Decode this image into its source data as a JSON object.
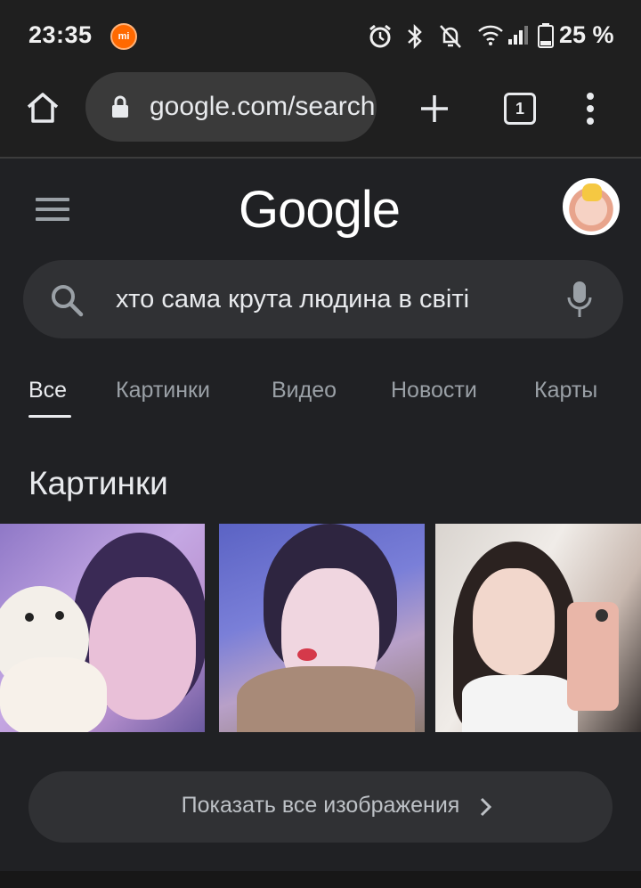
{
  "status_bar": {
    "time": "23:35",
    "mi_badge": "mi",
    "battery": "25 %",
    "icons": [
      "alarm-icon",
      "bluetooth-icon",
      "notifications-off-icon",
      "wifi-icon",
      "signal-icon",
      "battery-icon"
    ]
  },
  "browser": {
    "url": "google.com/search",
    "tab_count": "1",
    "icons": [
      "home-icon",
      "lock-icon",
      "new-tab-icon",
      "tab-switcher-icon",
      "more-menu-icon"
    ]
  },
  "google": {
    "logo": "Google"
  },
  "search": {
    "query": "хто сама крута людина в світі"
  },
  "tabs": [
    "Все",
    "Картинки",
    "Видео",
    "Новости",
    "Карты"
  ],
  "active_tab": "Все",
  "images_section": {
    "title": "Картинки",
    "show_all_label": "Показать все изображения"
  },
  "colors": {
    "background": "#202124",
    "search_box": "#303134",
    "text_primary": "#e8eaed",
    "text_secondary": "#9aa0a6"
  }
}
